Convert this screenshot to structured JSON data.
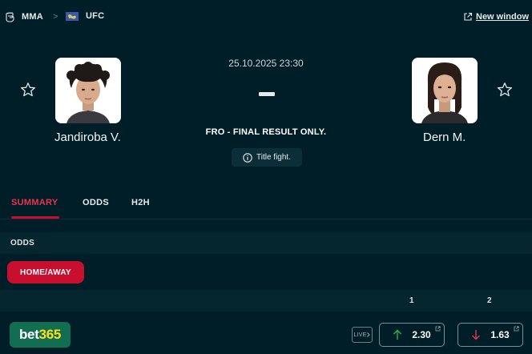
{
  "breadcrumb": {
    "sport": "MMA",
    "separator": ">",
    "league": "UFC"
  },
  "new_window": "New window",
  "match": {
    "date": "25.10.2025 23:30",
    "score_dash": "-",
    "status": "FRO - FINAL RESULT ONLY.",
    "note": "Title fight.",
    "home": {
      "name": "Jandiroba V."
    },
    "away": {
      "name": "Dern M."
    }
  },
  "tabs": [
    {
      "label": "SUMMARY",
      "active": true
    },
    {
      "label": "ODDS",
      "active": false
    },
    {
      "label": "H2H",
      "active": false
    }
  ],
  "odds": {
    "section_title": "ODDS",
    "market_button": "HOME/AWAY",
    "columns": [
      "1",
      "2"
    ],
    "bookmaker": {
      "name_part1": "bet",
      "name_part2": "365",
      "live_badge": "LIVE",
      "home_odd": "2.30",
      "home_trend": "up",
      "away_odd": "1.63",
      "away_trend": "down"
    }
  },
  "colors": {
    "background": "#001e28",
    "accent": "#c8102e",
    "bet365_green": "#126e51",
    "bet365_yellow": "#ffdf1b",
    "trend_up": "#1db954",
    "trend_down": "#e8344f"
  },
  "icons": {
    "sport": "fist-icon",
    "league": "world-flag-icon",
    "new_window": "external-link-icon",
    "favorite": "star-outline-icon",
    "note": "info-circle-icon"
  }
}
